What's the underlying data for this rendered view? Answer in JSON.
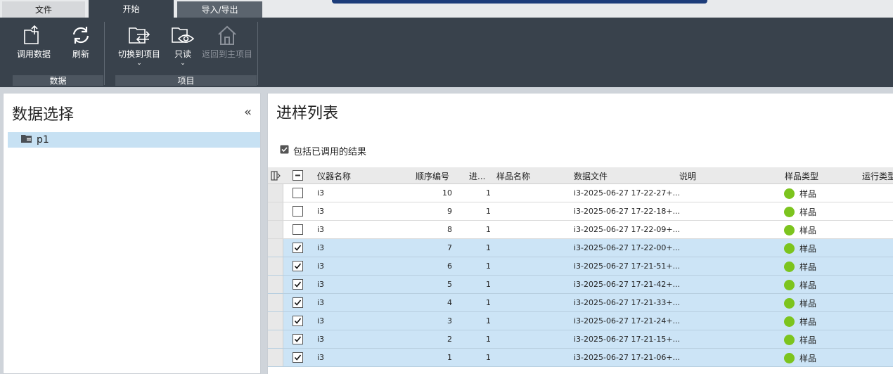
{
  "tabs": [
    {
      "label": "文件"
    },
    {
      "label": "开始"
    },
    {
      "label": "导入/导出"
    }
  ],
  "ribbon": {
    "load_data": "调用数据",
    "refresh": "刷新",
    "switch_project": "切换到项目",
    "read_only": "只读",
    "back_to_main": "返回到主项目",
    "group_data": "数据",
    "group_project": "项目"
  },
  "left_panel": {
    "title": "数据选择",
    "tree_item": "p1"
  },
  "right_panel": {
    "title": "进样列表",
    "include_loaded": "包括已调用的结果",
    "columns": {
      "instrument": "仪器名称",
      "seq_no": "顺序编号",
      "inj": "进...",
      "sample_name": "样品名称",
      "data_file": "数据文件",
      "desc": "说明",
      "sample_type": "样品类型",
      "run_type": "运行类型"
    },
    "rows": [
      {
        "checked": false,
        "instrument": "i3",
        "seq": "10",
        "inj": "1",
        "file": "i3-2025-06-27 17-22-27+...",
        "type": "样品"
      },
      {
        "checked": false,
        "instrument": "i3",
        "seq": "9",
        "inj": "1",
        "file": "i3-2025-06-27 17-22-18+...",
        "type": "样品"
      },
      {
        "checked": false,
        "instrument": "i3",
        "seq": "8",
        "inj": "1",
        "file": "i3-2025-06-27 17-22-09+...",
        "type": "样品"
      },
      {
        "checked": true,
        "instrument": "i3",
        "seq": "7",
        "inj": "1",
        "file": "i3-2025-06-27 17-22-00+...",
        "type": "样品"
      },
      {
        "checked": true,
        "instrument": "i3",
        "seq": "6",
        "inj": "1",
        "file": "i3-2025-06-27 17-21-51+...",
        "type": "样品"
      },
      {
        "checked": true,
        "instrument": "i3",
        "seq": "5",
        "inj": "1",
        "file": "i3-2025-06-27 17-21-42+...",
        "type": "样品"
      },
      {
        "checked": true,
        "instrument": "i3",
        "seq": "4",
        "inj": "1",
        "file": "i3-2025-06-27 17-21-33+...",
        "type": "样品"
      },
      {
        "checked": true,
        "instrument": "i3",
        "seq": "3",
        "inj": "1",
        "file": "i3-2025-06-27 17-21-24+...",
        "type": "样品"
      },
      {
        "checked": true,
        "instrument": "i3",
        "seq": "2",
        "inj": "1",
        "file": "i3-2025-06-27 17-21-15+...",
        "type": "样品"
      },
      {
        "checked": true,
        "instrument": "i3",
        "seq": "1",
        "inj": "1",
        "file": "i3-2025-06-27 17-21-06+...",
        "type": "样品"
      }
    ]
  },
  "colors": {
    "ribbon_bg": "#39424c",
    "selected_row": "#cce4f6",
    "sample_dot": "#7cc41e"
  }
}
